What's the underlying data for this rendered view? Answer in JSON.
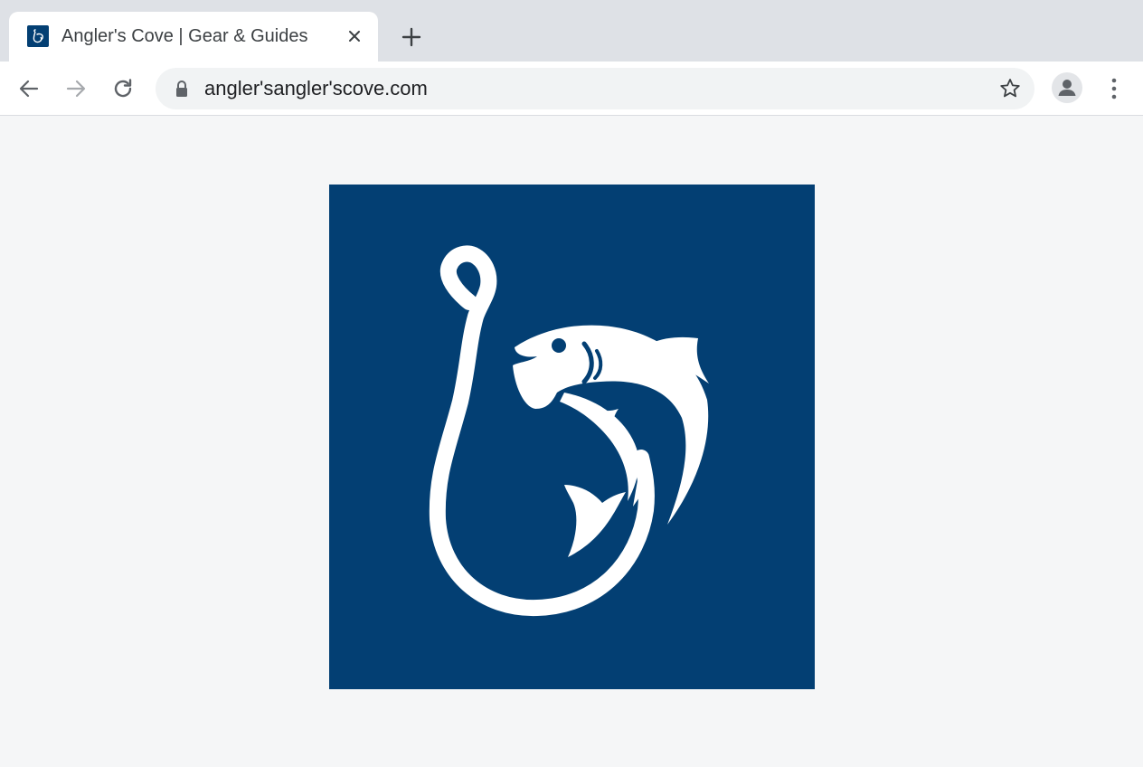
{
  "tab": {
    "title": "Angler's Cove | Gear & Guides",
    "favicon_icon": "fishhook-fish-icon",
    "close_icon": "close-icon"
  },
  "new_tab_icon": "plus-icon",
  "toolbar": {
    "back_icon": "arrow-left-icon",
    "forward_icon": "arrow-right-icon",
    "reload_icon": "reload-icon",
    "url": "angler'sangler'scove.com",
    "lock_icon": "lock-icon",
    "bookmark_icon": "star-icon",
    "profile_icon": "person-icon",
    "menu_icon": "more-vertical-icon"
  },
  "content": {
    "image_icon": "fishhook-fish-logo",
    "image_background": "#033f73"
  },
  "colors": {
    "brand_navy": "#033f73",
    "tabstrip": "#dee1e6",
    "omnibox": "#f1f3f4",
    "page_background": "#f5f6f7"
  }
}
